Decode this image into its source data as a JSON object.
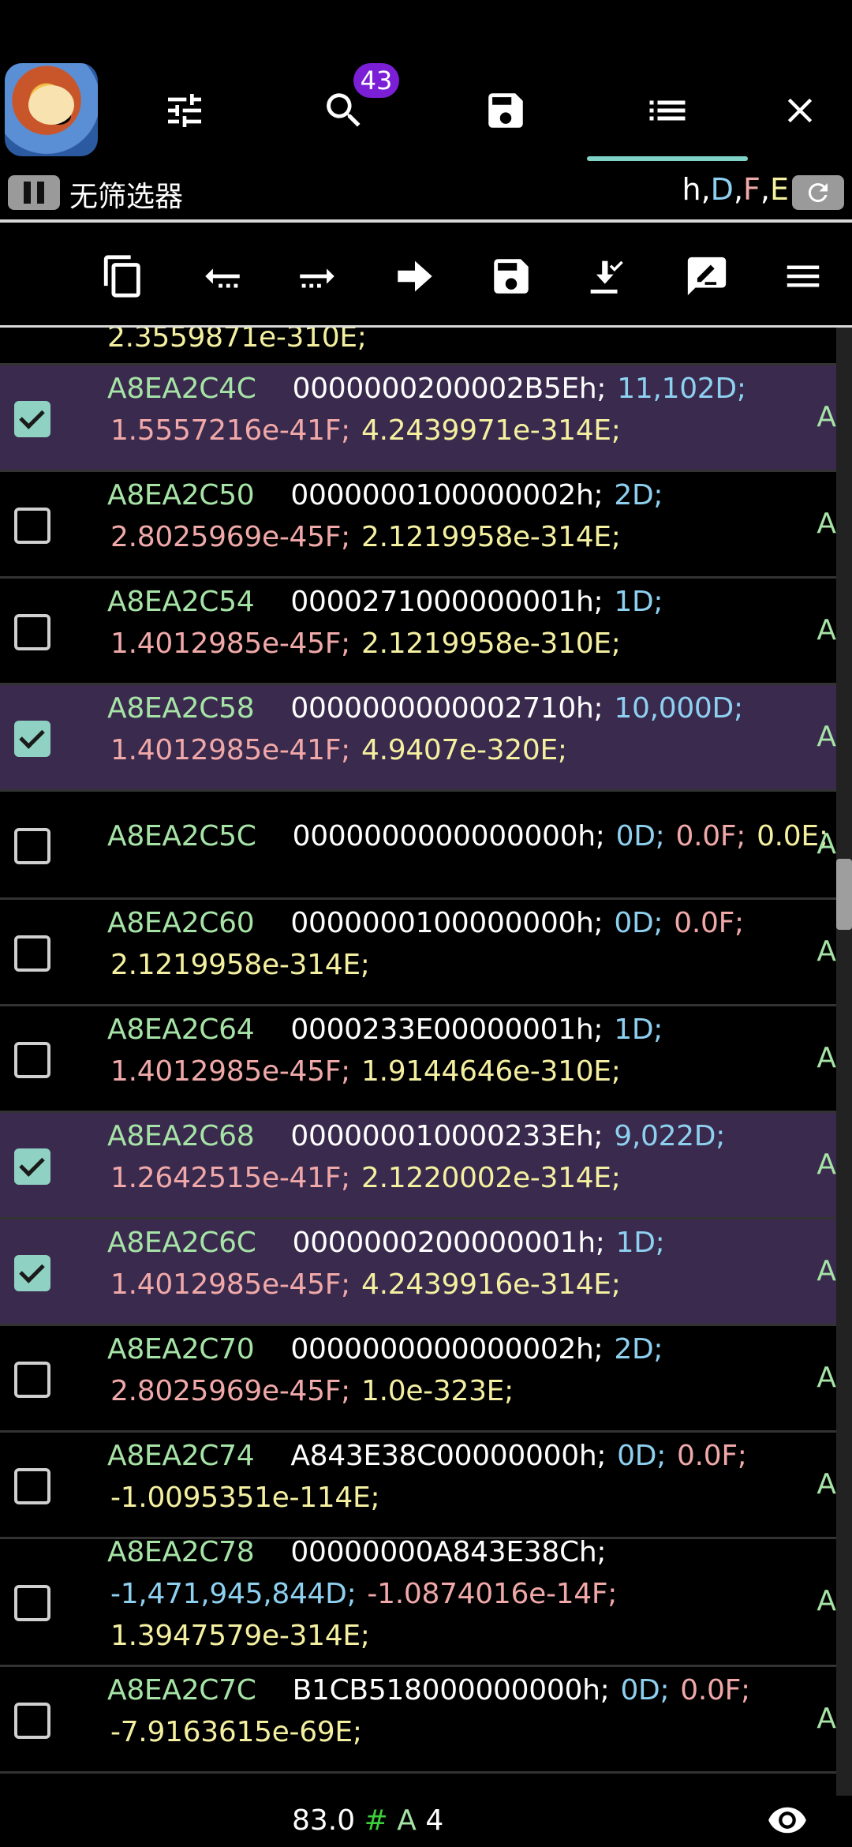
{
  "header": {
    "search_badge": "43",
    "filter_label": "无筛选器",
    "types": {
      "h": "h",
      "D": "D",
      "F": "F",
      "E": "E",
      "sep": ","
    }
  },
  "rows": [
    {
      "checked": false,
      "lines": [
        [
          {
            "t": "2.3559871e-310E;",
            "c": "dbl"
          }
        ]
      ],
      "partial": true
    },
    {
      "checked": true,
      "lines": [
        [
          {
            "t": "A8EA2C4C",
            "c": "addr"
          },
          {
            "t": "0000000200002B5Eh;",
            "c": "hex"
          },
          {
            "t": "11,102D;",
            "c": "dec"
          }
        ],
        [
          {
            "t": "1.5557216e-41F;",
            "c": "flt"
          },
          {
            "t": "4.2439971e-314E;",
            "c": "dbl"
          }
        ]
      ]
    },
    {
      "checked": false,
      "lines": [
        [
          {
            "t": "A8EA2C50",
            "c": "addr"
          },
          {
            "t": "0000000100000002h;",
            "c": "hex"
          },
          {
            "t": "2D;",
            "c": "dec"
          }
        ],
        [
          {
            "t": "2.8025969e-45F;",
            "c": "flt"
          },
          {
            "t": "2.1219958e-314E;",
            "c": "dbl"
          }
        ]
      ]
    },
    {
      "checked": false,
      "lines": [
        [
          {
            "t": "A8EA2C54",
            "c": "addr"
          },
          {
            "t": "0000271000000001h;",
            "c": "hex"
          },
          {
            "t": "1D;",
            "c": "dec"
          }
        ],
        [
          {
            "t": "1.4012985e-45F;",
            "c": "flt"
          },
          {
            "t": "2.1219958e-310E;",
            "c": "dbl"
          }
        ]
      ]
    },
    {
      "checked": true,
      "lines": [
        [
          {
            "t": "A8EA2C58",
            "c": "addr"
          },
          {
            "t": "0000000000002710h;",
            "c": "hex"
          },
          {
            "t": "10,000D;",
            "c": "dec"
          }
        ],
        [
          {
            "t": "1.4012985e-41F;",
            "c": "flt"
          },
          {
            "t": "4.9407e-320E;",
            "c": "dbl"
          }
        ]
      ]
    },
    {
      "checked": false,
      "lines": [
        [
          {
            "t": "A8EA2C5C",
            "c": "addr"
          },
          {
            "t": "0000000000000000h;",
            "c": "hex"
          },
          {
            "t": "0D;",
            "c": "dec"
          },
          {
            "t": "0.0F;",
            "c": "flt"
          },
          {
            "t": "0.0E;",
            "c": "dbl"
          }
        ]
      ]
    },
    {
      "checked": false,
      "lines": [
        [
          {
            "t": "A8EA2C60",
            "c": "addr"
          },
          {
            "t": "0000000100000000h;",
            "c": "hex"
          },
          {
            "t": "0D;",
            "c": "dec"
          },
          {
            "t": "0.0F;",
            "c": "flt"
          }
        ],
        [
          {
            "t": "2.1219958e-314E;",
            "c": "dbl"
          }
        ]
      ]
    },
    {
      "checked": false,
      "lines": [
        [
          {
            "t": "A8EA2C64",
            "c": "addr"
          },
          {
            "t": "0000233E00000001h;",
            "c": "hex"
          },
          {
            "t": "1D;",
            "c": "dec"
          }
        ],
        [
          {
            "t": "1.4012985e-45F;",
            "c": "flt"
          },
          {
            "t": "1.9144646e-310E;",
            "c": "dbl"
          }
        ]
      ]
    },
    {
      "checked": true,
      "lines": [
        [
          {
            "t": "A8EA2C68",
            "c": "addr"
          },
          {
            "t": "000000010000233Eh;",
            "c": "hex"
          },
          {
            "t": "9,022D;",
            "c": "dec"
          }
        ],
        [
          {
            "t": "1.2642515e-41F;",
            "c": "flt"
          },
          {
            "t": "2.1220002e-314E;",
            "c": "dbl"
          }
        ]
      ]
    },
    {
      "checked": true,
      "lines": [
        [
          {
            "t": "A8EA2C6C",
            "c": "addr"
          },
          {
            "t": "0000000200000001h;",
            "c": "hex"
          },
          {
            "t": "1D;",
            "c": "dec"
          }
        ],
        [
          {
            "t": "1.4012985e-45F;",
            "c": "flt"
          },
          {
            "t": "4.2439916e-314E;",
            "c": "dbl"
          }
        ]
      ]
    },
    {
      "checked": false,
      "lines": [
        [
          {
            "t": "A8EA2C70",
            "c": "addr"
          },
          {
            "t": "0000000000000002h;",
            "c": "hex"
          },
          {
            "t": "2D;",
            "c": "dec"
          }
        ],
        [
          {
            "t": "2.8025969e-45F;",
            "c": "flt"
          },
          {
            "t": "1.0e-323E;",
            "c": "dbl"
          }
        ]
      ]
    },
    {
      "checked": false,
      "lines": [
        [
          {
            "t": "A8EA2C74",
            "c": "addr"
          },
          {
            "t": "A843E38C00000000h;",
            "c": "hex"
          },
          {
            "t": "0D;",
            "c": "dec"
          },
          {
            "t": "0.0F;",
            "c": "flt"
          }
        ],
        [
          {
            "t": "-1.0095351e-114E;",
            "c": "dbl"
          }
        ]
      ]
    },
    {
      "checked": false,
      "lines": [
        [
          {
            "t": "A8EA2C78",
            "c": "addr"
          },
          {
            "t": "00000000A843E38Ch;",
            "c": "hex"
          }
        ],
        [
          {
            "t": "-1,471,945,844D;",
            "c": "dec"
          },
          {
            "t": "-1.0874016e-14F;",
            "c": "flt"
          }
        ],
        [
          {
            "t": "1.3947579e-314E;",
            "c": "dbl"
          }
        ]
      ]
    },
    {
      "checked": false,
      "lines": [
        [
          {
            "t": "A8EA2C7C",
            "c": "addr"
          },
          {
            "t": "B1CB518000000000h;",
            "c": "hex"
          },
          {
            "t": "0D;",
            "c": "dec"
          },
          {
            "t": "0.0F;",
            "c": "flt"
          }
        ],
        [
          {
            "t": "-7.9163615e-69E;",
            "c": "dbl"
          }
        ]
      ]
    }
  ],
  "row_type_label": "A",
  "footer": {
    "value": "83.0",
    "hash": "#",
    "type": "A",
    "count": "4"
  }
}
